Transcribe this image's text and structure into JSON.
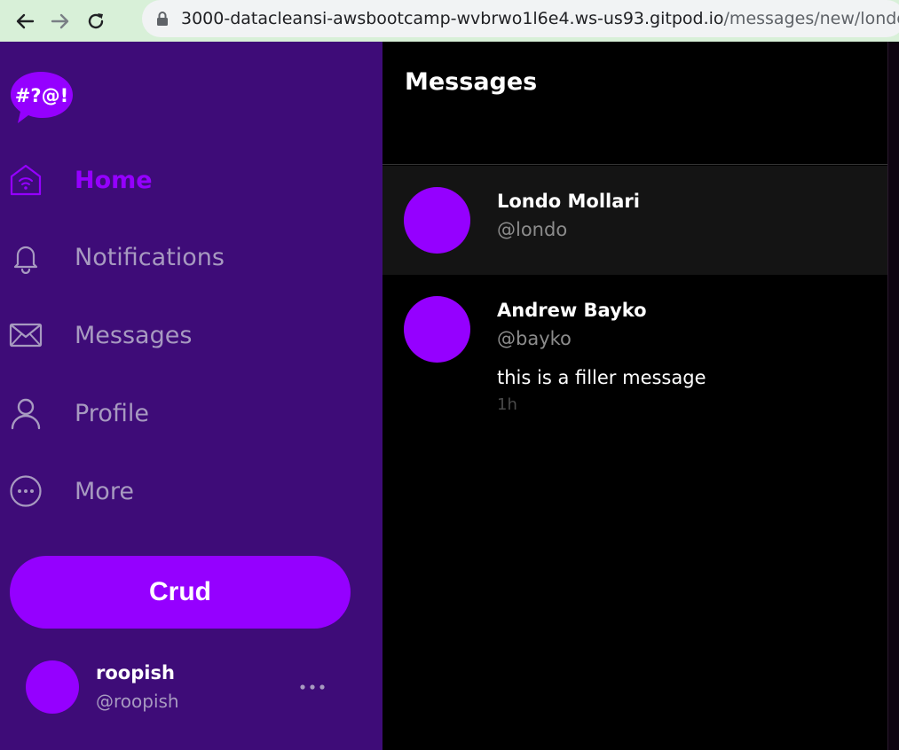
{
  "browser": {
    "url_host": "3000-datacleansi-awsbootcamp-wvbrwo1l6e4.ws-us93.gitpod.io",
    "url_path": "/messages/new/londo"
  },
  "sidebar": {
    "logo_text": "#?@!",
    "items": [
      {
        "label": "Home",
        "icon": "home-icon",
        "active": true
      },
      {
        "label": "Notifications",
        "icon": "bell-icon",
        "active": false
      },
      {
        "label": "Messages",
        "icon": "envelope-icon",
        "active": false
      },
      {
        "label": "Profile",
        "icon": "user-icon",
        "active": false
      },
      {
        "label": "More",
        "icon": "more-circle-icon",
        "active": false
      }
    ],
    "crud_label": "Crud",
    "profile": {
      "name": "roopish",
      "handle": "@roopish"
    }
  },
  "main": {
    "title": "Messages",
    "groups": [
      {
        "name": "Londo Mollari",
        "handle": "@londo",
        "selected": true
      },
      {
        "name": "Andrew Bayko",
        "handle": "@bayko",
        "message": "this is a filler message",
        "time": "1h",
        "selected": false
      }
    ]
  },
  "colors": {
    "accent": "#9500ff",
    "sidebar_bg": "#3e0c78",
    "main_bg": "#000000"
  }
}
